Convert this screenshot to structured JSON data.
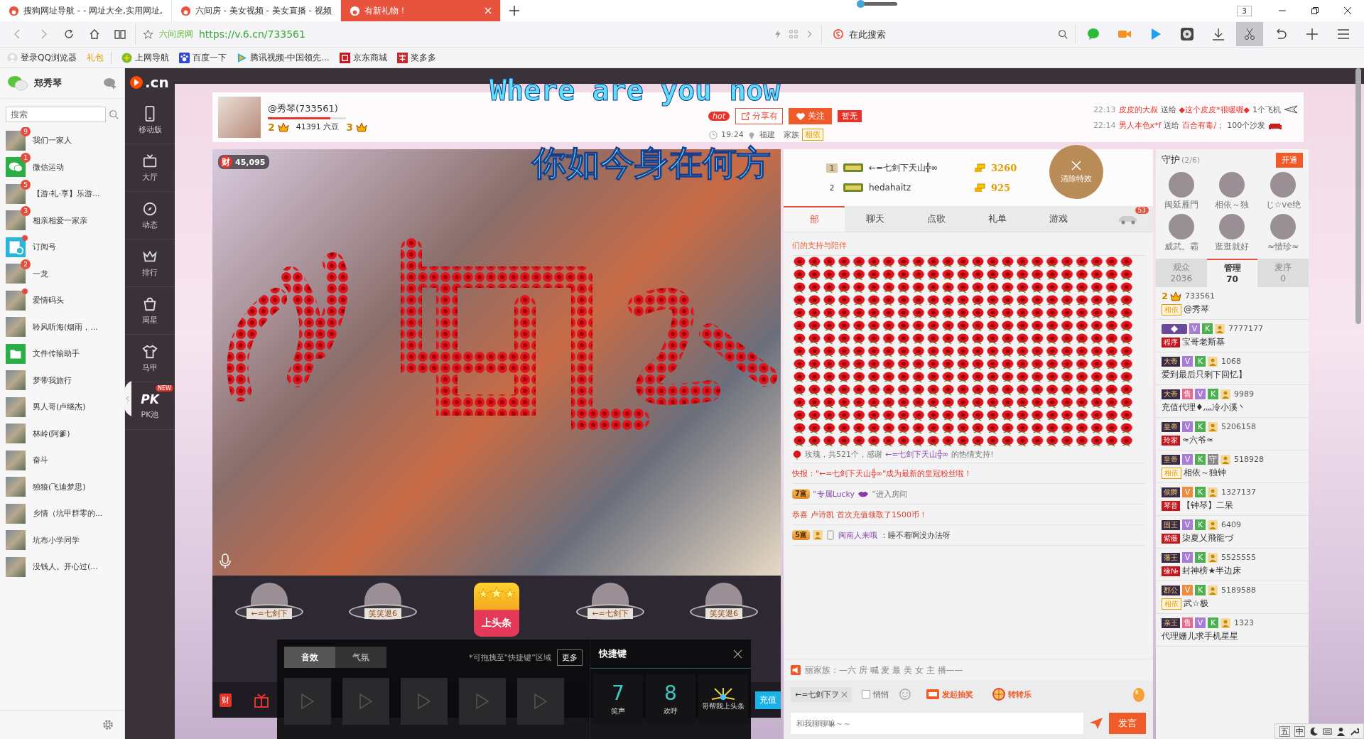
{
  "browser": {
    "tabs": [
      {
        "title": "搜狗网址导航 - - 网址大全,实用网址,",
        "selected": false
      },
      {
        "title": "六间房 - 美女视频 - 美女直播 - 视频",
        "selected": false
      },
      {
        "title": "有新礼物！",
        "selected": true
      }
    ],
    "zoom_slider": {
      "level": 0
    },
    "window_count": "3",
    "site_name": "六间房网",
    "url": "https://v.6.cn/733561",
    "search_placeholder": "在此搜索",
    "bookmarks": [
      {
        "label": "登录QQ浏览器",
        "kind": "account"
      },
      {
        "label": "礼包",
        "kind": "promo"
      },
      {
        "label": "上网导航",
        "kind": "nav"
      },
      {
        "label": "百度一下",
        "kind": "paw"
      },
      {
        "label": "腾讯视频-中国领先...",
        "kind": "video"
      },
      {
        "label": "京东商城",
        "kind": "shop"
      },
      {
        "label": "奖多多",
        "kind": "reward"
      }
    ]
  },
  "wechat": {
    "user": "郑秀琴",
    "search_placeholder": "搜索",
    "chats": [
      {
        "name": "我们一家人",
        "kind": "photo",
        "badge": "9",
        "unread": false
      },
      {
        "name": "微信运动",
        "kind": "sport",
        "badge": "1",
        "unread": false
      },
      {
        "name": "【游·礼·享】乐游...",
        "kind": "photo",
        "badge": "5",
        "unread": false
      },
      {
        "name": "相亲相爱一家亲",
        "kind": "photo",
        "badge": "3",
        "unread": false
      },
      {
        "name": "订阅号",
        "kind": "subscription",
        "unread": true
      },
      {
        "name": "一龙",
        "kind": "photo",
        "badge": "2",
        "unread": false
      },
      {
        "name": "爱情码头",
        "kind": "photo",
        "unread": true
      },
      {
        "name": "聆风听海(烟雨，...",
        "kind": "photo",
        "unread": false
      },
      {
        "name": "文件传输助手",
        "kind": "file",
        "unread": false
      },
      {
        "name": "梦带我旅行",
        "kind": "photo",
        "unread": false
      },
      {
        "name": "男人哥(卢继杰)",
        "kind": "photo",
        "unread": false
      },
      {
        "name": "林岭(阿爹)",
        "kind": "photo",
        "unread": false
      },
      {
        "name": "奋斗",
        "kind": "photo",
        "unread": false
      },
      {
        "name": "独狼(飞迪梦思)",
        "kind": "photo",
        "unread": false
      },
      {
        "name": "乡情（坑甲群零的...",
        "kind": "photo",
        "unread": false
      },
      {
        "name": "坑布小学同学",
        "kind": "photo",
        "unread": false
      },
      {
        "name": "没钱人。开心过(...",
        "kind": "photo",
        "unread": false
      }
    ]
  },
  "site": {
    "logo": ".cn",
    "nav": [
      {
        "label": "移动版",
        "kind": "phone"
      },
      {
        "label": "大厅",
        "kind": "tv"
      },
      {
        "label": "动态",
        "kind": "compass"
      },
      {
        "label": "排行",
        "kind": "crown"
      },
      {
        "label": "周星",
        "kind": "bag"
      },
      {
        "label": "马甲",
        "kind": "shirt"
      },
      {
        "label": "PK池",
        "kind": "pk",
        "logo": "PK",
        "badge": "NEW"
      }
    ]
  },
  "room": {
    "host": {
      "name": "@秀琴(733561)",
      "level": 0.8,
      "rank": "2",
      "beans": "41391 六豆",
      "fans_rank": "3"
    },
    "hot": "hot",
    "share": "分享有",
    "follow": "关注",
    "flag": "暂无",
    "time": "19:24",
    "place": "福建",
    "family_label": "家族",
    "family": "相依",
    "gift_feed": [
      {
        "time": "22:13",
        "sender": "皮皮的大叔",
        "verb": "送给",
        "receiver": "◆这个皮皮*很暖喔◆",
        "count": "1个飞机"
      },
      {
        "time": "22:14",
        "sender": "男人本色x*f",
        "verb": "送给",
        "receiver": "百合有毒/；",
        "count": "100个沙发"
      }
    ],
    "lyric_en": "Where are you now",
    "lyric_cn": "你如今身在何方",
    "viewers": "45,095",
    "wealth_icon": "财"
  },
  "stage_avatars": [
    {
      "kind": "user",
      "name": "←=七剑下"
    },
    {
      "kind": "user",
      "name": "笑笑退6"
    },
    {
      "kind": "headline",
      "name": "上头条"
    },
    {
      "kind": "user",
      "name": "←=七剑下"
    },
    {
      "kind": "user",
      "name": "笑笑退6"
    }
  ],
  "toolbar": {
    "wealth": "财",
    "recharge": "充值"
  },
  "sound_popup": {
    "tabs": [
      {
        "label": "音效",
        "selected": true
      },
      {
        "label": "气氛",
        "selected": false
      }
    ],
    "hint": "*可拖拽至“快捷键”区域",
    "more": "更多",
    "shortcut_title": "快捷键",
    "shortcuts": [
      {
        "key": "7",
        "label": "笑声"
      },
      {
        "key": "8",
        "label": "欢呼"
      },
      {
        "label": "哥帮我上头条"
      }
    ]
  },
  "ranking": [
    {
      "rank": "1",
      "name": "←=七剑下天山╬∞",
      "score": "3260"
    },
    {
      "rank": "2",
      "name": "hedahaitz",
      "score": "925"
    }
  ],
  "clear_effects": "清除特效",
  "chat": {
    "tabs": [
      {
        "label": "部",
        "selected": true
      },
      {
        "label": "聊天",
        "selected": false
      },
      {
        "label": "点歌",
        "selected": false
      },
      {
        "label": "礼单",
        "selected": false
      },
      {
        "label": "游戏",
        "selected": false
      }
    ],
    "car_badge": "53",
    "messages": [
      {
        "kind": "thanks",
        "text": "们的支持与陪伴"
      },
      {
        "kind": "gift",
        "text": "玫瑰，共521个，感谢",
        "user": "←=七剑下天山╬∞",
        "tail": "的热情支持!"
      },
      {
        "kind": "news",
        "text": "快报：\"←=七剑下天山╬∞\"成为最新的皇冠粉丝啦！"
      },
      {
        "kind": "enter",
        "level": "7富",
        "user": "“专属Lucky",
        "tail": "”进入房间"
      },
      {
        "kind": "recharge",
        "text": "恭喜",
        "user": "卢诗凯",
        "tail": "首次充值领取了1500币！"
      },
      {
        "kind": "chat",
        "level": "5富",
        "user": "闽南人来哦",
        "text": "：睡不着啊没办法呀"
      }
    ],
    "notice": "丽家族：—六 房 喊 麦 最 美 女 主 播——",
    "target": "←=七剑下ヲ",
    "whisper": {
      "label": "悄悄",
      "checked": false
    },
    "lottery": "发起抽奖",
    "wheel": "转转乐",
    "input_placeholder": "和我聊聊嘛～～",
    "send": "发言"
  },
  "guard": {
    "title": "守护",
    "count": "(2/6)",
    "open": "开通",
    "members": [
      "闽延雁門",
      "相依～独",
      "じ☆ve绝",
      "威武。霸",
      "逛逛就好",
      "≈惜珍≈"
    ]
  },
  "audience_tabs": [
    {
      "label": "观众",
      "count": "2036",
      "selected": false
    },
    {
      "label": "管理",
      "count": "70",
      "selected": true
    },
    {
      "label": "麦序",
      "count": "0",
      "selected": false
    }
  ],
  "admins": [
    {
      "rank": "2",
      "id": "733561",
      "tag": {
        "label": "相依",
        "kind": "family"
      },
      "name": "@秀琴"
    },
    {
      "id": "7777177",
      "badges": [
        {
          "label": "V",
          "color": "#a77bd6"
        },
        {
          "label": "K",
          "color": "#4cb050"
        }
      ],
      "tag": {
        "label": "程序",
        "kind": "title"
      },
      "name": "宝哥老斯基"
    },
    {
      "title": "大帝",
      "id": "1068",
      "badges": [
        {
          "label": "V",
          "color": "#a77bd6"
        },
        {
          "label": "K",
          "color": "#4cb050"
        }
      ],
      "name": "爱到最后只剩下回忆】"
    },
    {
      "title": "大帝",
      "id": "9989",
      "badges": [
        {
          "label": "售",
          "color": "#e26a8c"
        },
        {
          "label": "V",
          "color": "#a77bd6"
        },
        {
          "label": "K",
          "color": "#4cb050"
        }
      ],
      "name": "充值代理♦灬冷小溪丶"
    },
    {
      "title": "皇帝",
      "id": "5206158",
      "badges": [
        {
          "label": "V",
          "color": "#a77bd6"
        },
        {
          "label": "K",
          "color": "#4cb050"
        }
      ],
      "tag": {
        "label": "玲家",
        "kind": "title"
      },
      "name": "≈六爷≈"
    },
    {
      "title": "皇帝",
      "id": "518928",
      "badges": [
        {
          "label": "V",
          "color": "#a77bd6"
        },
        {
          "label": "K",
          "color": "#4cb050"
        },
        {
          "label": "守",
          "color": "#8a8a8a"
        }
      ],
      "tag": {
        "label": "相依",
        "kind": "family"
      },
      "name": "相依～独钟"
    },
    {
      "title": "侯爵",
      "id": "1327137",
      "badges": [
        {
          "label": "V",
          "color": "#f08a3c"
        },
        {
          "label": "K",
          "color": "#4cb050"
        }
      ],
      "tag": {
        "label": "琴音",
        "kind": "title"
      },
      "name": "【钟琴】二呆"
    },
    {
      "title": "国王",
      "id": "6409",
      "badges": [
        {
          "label": "V",
          "color": "#a77bd6"
        },
        {
          "label": "K",
          "color": "#4cb050"
        }
      ],
      "tag": {
        "label": "紫薇",
        "kind": "title"
      },
      "name": "柒夏乂飛龍づ"
    },
    {
      "title": "藩王",
      "id": "5525555",
      "badges": [
        {
          "label": "V",
          "color": "#a77bd6"
        },
        {
          "label": "K",
          "color": "#4cb050"
        }
      ],
      "tag": {
        "label": "缘№",
        "kind": "title"
      },
      "name": "封神榜★半边床"
    },
    {
      "title": "郡公",
      "id": "5189588",
      "badges": [
        {
          "label": "V",
          "color": "#f08a3c"
        },
        {
          "label": "K",
          "color": "#4cb050"
        }
      ],
      "tag": {
        "label": "相依",
        "kind": "family"
      },
      "name": "武☆极"
    },
    {
      "title": "亲王",
      "id": "1323",
      "badges": [
        {
          "label": "售",
          "color": "#e26a8c"
        },
        {
          "label": "V",
          "color": "#a77bd6"
        },
        {
          "label": "K",
          "color": "#4cb050"
        }
      ],
      "name": "代理姗儿求手机星星"
    }
  ],
  "tray": [
    "五",
    "中"
  ]
}
